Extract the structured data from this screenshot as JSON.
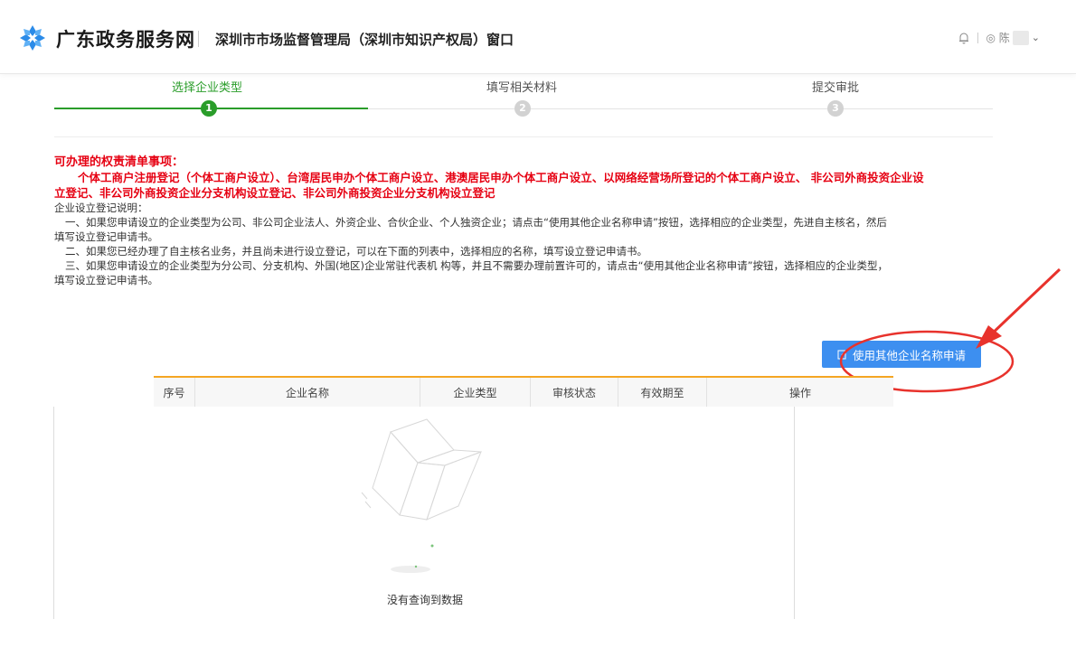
{
  "header": {
    "site_name": "广东政务服务网",
    "window_title": "深圳市市场监督管理局（深圳市知识产权局）窗口",
    "user_label": "◎ 陈",
    "logo_color": "#2b8be8"
  },
  "steps": [
    {
      "label": "选择企业类型",
      "number": "1",
      "active": true
    },
    {
      "label": "填写相关材料",
      "number": "2",
      "active": false
    },
    {
      "label": "提交审批",
      "number": "3",
      "active": false
    }
  ],
  "notice": {
    "title": "可办理的权责清单事项：",
    "items_line1": "个体工商户注册登记（个体工商户设立）、台湾居民申办个体工商户设立、港澳居民申办个体工商户设立、以网络经营场所登记的个体工商户设立、 非公司外商投资企业设",
    "items_line2": "立登记、非公司外商投资企业分支机构设立登记、非公司外商投资企业分支机构设立登记",
    "desc_title": "企业设立登记说明：",
    "desc1_a": "一、如果您申请设立的企业类型为公司、非公司企业法人、外资企业、合伙企业、个人独资企业；请点击“使用其他企业名称申请”按钮，选择相应的企业类型，先进自主核名，然后",
    "desc1_b": "填写设立登记申请书。",
    "desc2": "二、如果您已经办理了自主核名业务，并且尚未进行设立登记，可以在下面的列表中，选择相应的名称，填写设立登记申请书。",
    "desc3_a": "三、如果您申请设立的企业类型为分公司、分支机构、外国(地区)企业常驻代表机 构等，并且不需要办理前置许可的，请点击“使用其他企业名称申请”按钮，选择相应的企业类型，",
    "desc3_b": "填写设立登记申请书。"
  },
  "actions": {
    "other_name_button": "使用其他企业名称申请",
    "button_color": "#3d8ff0"
  },
  "table": {
    "columns": [
      "序号",
      "企业名称",
      "企业类型",
      "审核状态",
      "有效期至",
      "操作"
    ],
    "rows": [],
    "empty_text": "没有查询到数据"
  },
  "colors": {
    "step_active": "#2a9d2a",
    "alert_red": "#e60012",
    "table_accent": "#f5a623"
  }
}
